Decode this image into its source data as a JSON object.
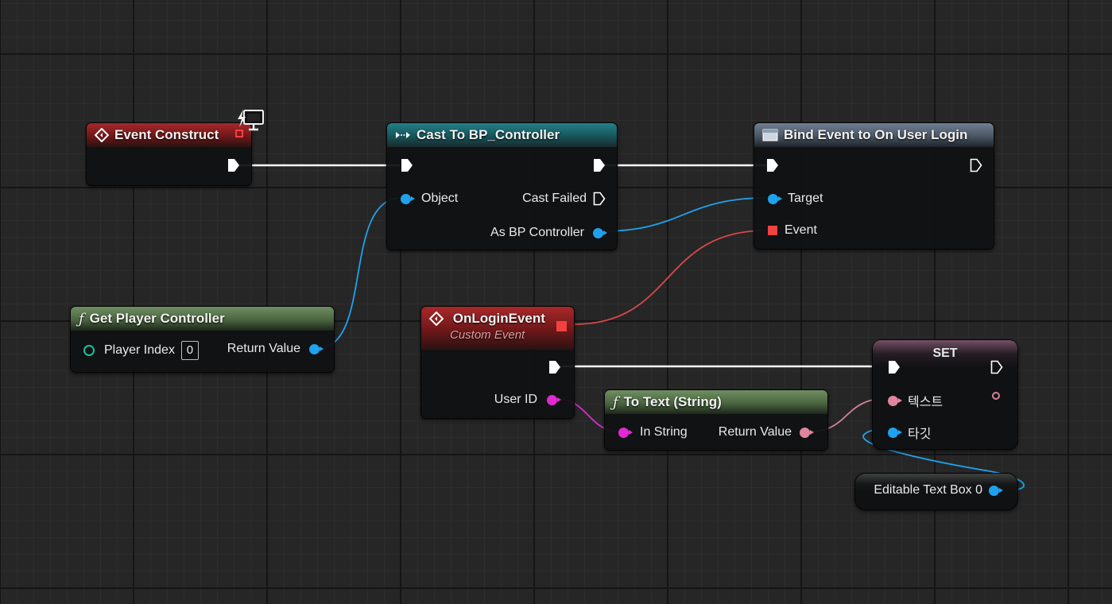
{
  "graph": {
    "event_construct": {
      "title": "Event Construct"
    },
    "cast_node": {
      "title": "Cast To BP_Controller",
      "object_label": "Object",
      "cast_failed_label": "Cast Failed",
      "as_label": "As BP Controller"
    },
    "bind_node": {
      "title": "Bind Event to On User Login",
      "target_label": "Target",
      "event_label": "Event"
    },
    "get_pc_node": {
      "title": "Get Player Controller",
      "player_index_label": "Player Index",
      "player_index_value": "0",
      "return_label": "Return Value"
    },
    "login_event_node": {
      "title": "OnLoginEvent",
      "subtitle": "Custom Event",
      "user_id_label": "User ID"
    },
    "to_text_node": {
      "title": "To Text (String)",
      "in_label": "In String",
      "return_label": "Return Value"
    },
    "set_node": {
      "title": "SET",
      "text_label": "텍스트",
      "target_label": "타깃"
    },
    "var_node": {
      "label": "Editable Text Box 0"
    }
  },
  "icons": {
    "event": "event-diamond-icon",
    "cast": "cast-arrows-icon",
    "bind": "window-icon",
    "function": "function-f-icon",
    "client": "monitor-lightning-icon"
  },
  "colors": {
    "exec": "#ffffff",
    "object_pin": "#1fa2ee",
    "delegate_pin": "#f04242",
    "string_pin": "#e02ad0",
    "text_pin": "#e0869c",
    "int_pin": "#19c0a0"
  }
}
